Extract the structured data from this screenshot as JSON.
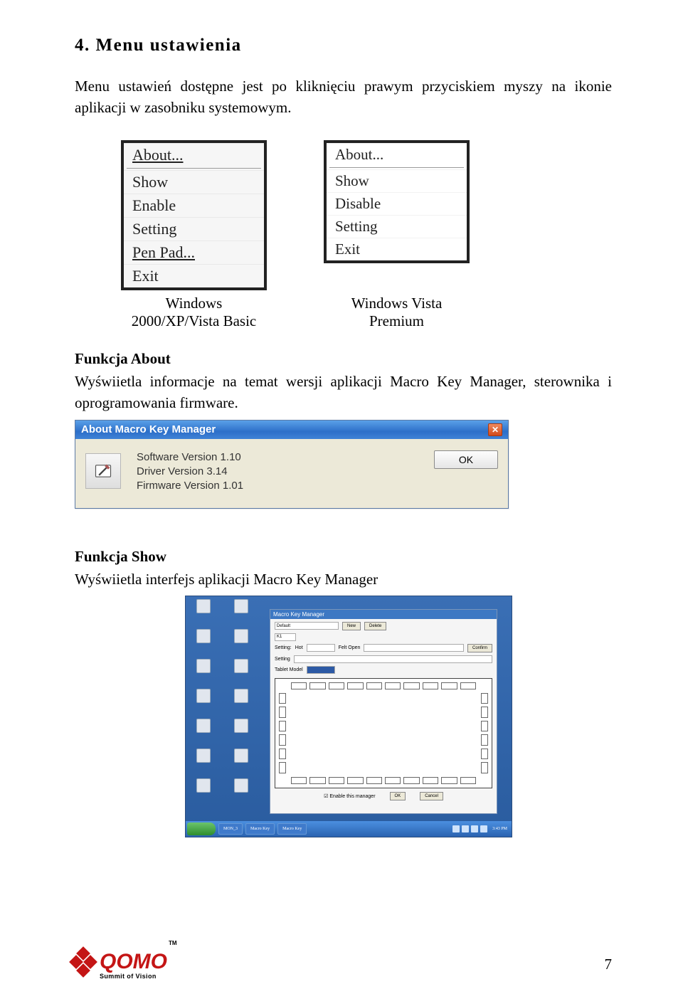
{
  "heading": "4. Menu ustawienia",
  "paragraph": "Menu ustawień dostępne jest po kliknięciu prawym przyciskiem myszy na ikonie aplikacji w zasobniku systemowym.",
  "menu1": {
    "items": [
      "About...",
      "Show",
      "Enable",
      "Setting",
      "Pen Pad...",
      "Exit"
    ],
    "caption": "Windows 2000/XP/Vista Basic"
  },
  "menu2": {
    "items": [
      "About...",
      "Show",
      "Disable",
      "Setting",
      "Exit"
    ],
    "caption": "Windows Vista Premium"
  },
  "about_section": {
    "subhead": "Funkcja About",
    "desc": "Wyświietla informacje na temat wersji aplikacji Macro Key Manager, sterownika i oprogramowania firmware."
  },
  "about_dialog": {
    "title": "About Macro Key Manager",
    "lines": [
      "Software Version 1.10",
      "Driver Version 3.14",
      "Firmware Version 1.01"
    ],
    "ok": "OK"
  },
  "show_section": {
    "subhead": "Funkcja Show",
    "desc": "Wyświietla interfejs aplikacji Macro Key Manager"
  },
  "mkm_window": {
    "title": "Macro Key Manager",
    "profile": "Default",
    "new": "New",
    "delete": "Delete",
    "key": "K1",
    "setting": "Setting:",
    "opt1": "Hot",
    "opt2": "Felt Open",
    "confirm": "Confirm",
    "hint": "Setting",
    "tablet_label": "Tablet Model",
    "enable_cb": "Enable this manager",
    "ok": "OK",
    "cancel": "Cancel"
  },
  "taskbar": {
    "items": [
      "",
      "MON_3",
      "",
      "Macro Key",
      "",
      "Macro Key"
    ],
    "clock": "3:43 PM"
  },
  "footer": {
    "brand_main": "QOMO",
    "brand_sub": "Summit of Vision",
    "tm": "TM",
    "page": "7"
  }
}
